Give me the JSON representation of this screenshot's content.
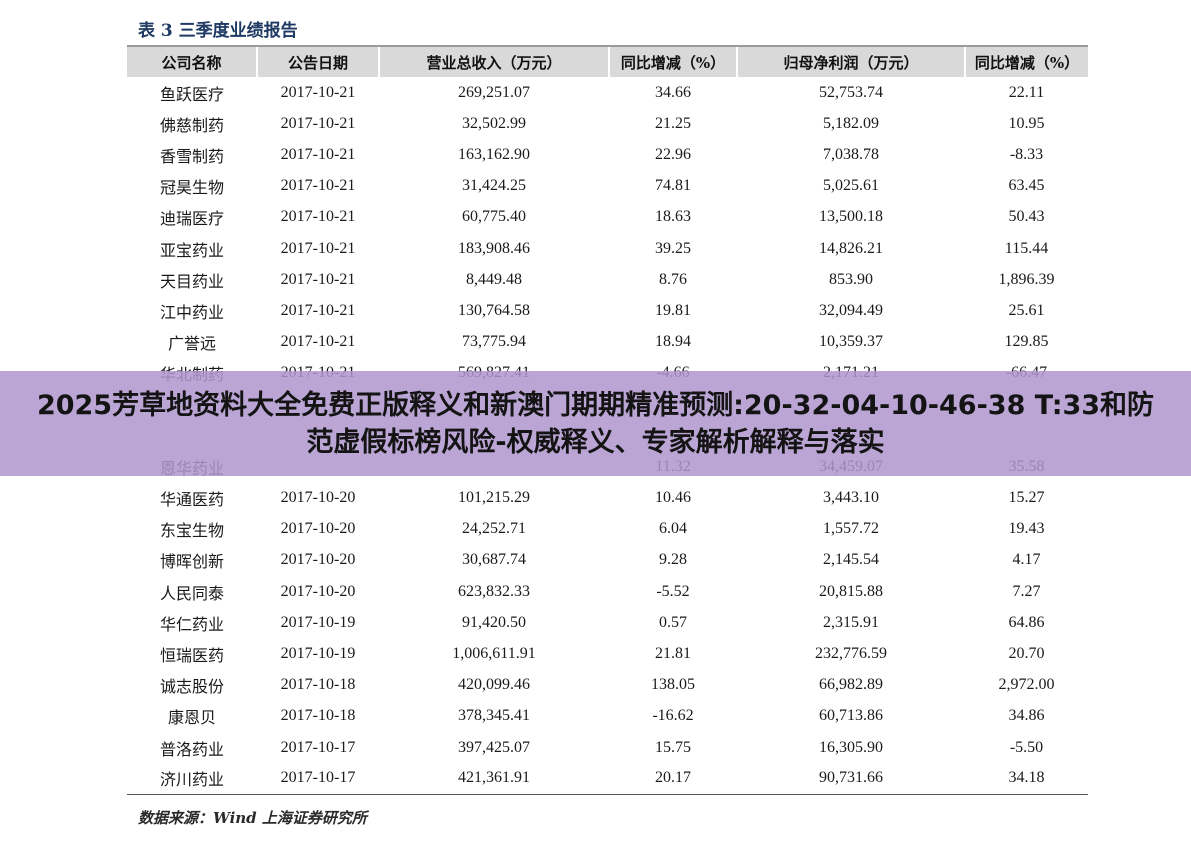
{
  "title": "表 3 三季度业绩报告",
  "table": {
    "headers": [
      "公司名称",
      "公告日期",
      "营业总收入（万元）",
      "同比增减（%）",
      "归母净利润（万元）",
      "同比增减（%）"
    ],
    "rows": [
      [
        "鱼跃医疗",
        "2017-10-21",
        "269,251.07",
        "34.66",
        "52,753.74",
        "22.11"
      ],
      [
        "佛慈制药",
        "2017-10-21",
        "32,502.99",
        "21.25",
        "5,182.09",
        "10.95"
      ],
      [
        "香雪制药",
        "2017-10-21",
        "163,162.90",
        "22.96",
        "7,038.78",
        "-8.33"
      ],
      [
        "冠昊生物",
        "2017-10-21",
        "31,424.25",
        "74.81",
        "5,025.61",
        "63.45"
      ],
      [
        "迪瑞医疗",
        "2017-10-21",
        "60,775.40",
        "18.63",
        "13,500.18",
        "50.43"
      ],
      [
        "亚宝药业",
        "2017-10-21",
        "183,908.46",
        "39.25",
        "14,826.21",
        "115.44"
      ],
      [
        "天目药业",
        "2017-10-21",
        "8,449.48",
        "8.76",
        "853.90",
        "1,896.39"
      ],
      [
        "江中药业",
        "2017-10-21",
        "130,764.58",
        "19.81",
        "32,094.49",
        "25.61"
      ],
      [
        "广誉远",
        "2017-10-21",
        "73,775.94",
        "18.94",
        "10,359.37",
        "129.85"
      ],
      [
        "华北制药",
        "2017-10-21",
        "569,827.41",
        "-4.66",
        "2,171.21",
        "-66.47"
      ],
      [
        "",
        "",
        "",
        "",
        "",
        ""
      ],
      [
        "",
        "",
        "",
        "",
        "",
        ""
      ],
      [
        "恩华药业",
        "",
        "",
        "11.32",
        "34,459.07",
        "35.58"
      ],
      [
        "华通医药",
        "2017-10-20",
        "101,215.29",
        "10.46",
        "3,443.10",
        "15.27"
      ],
      [
        "东宝生物",
        "2017-10-20",
        "24,252.71",
        "6.04",
        "1,557.72",
        "19.43"
      ],
      [
        "博晖创新",
        "2017-10-20",
        "30,687.74",
        "9.28",
        "2,145.54",
        "4.17"
      ],
      [
        "人民同泰",
        "2017-10-20",
        "623,832.33",
        "-5.52",
        "20,815.88",
        "7.27"
      ],
      [
        "华仁药业",
        "2017-10-19",
        "91,420.50",
        "0.57",
        "2,315.91",
        "64.86"
      ],
      [
        "恒瑞医药",
        "2017-10-19",
        "1,006,611.91",
        "21.81",
        "232,776.59",
        "20.70"
      ],
      [
        "诚志股份",
        "2017-10-18",
        "420,099.46",
        "138.05",
        "66,982.89",
        "2,972.00"
      ],
      [
        "康恩贝",
        "2017-10-18",
        "378,345.41",
        "-16.62",
        "60,713.86",
        "34.86"
      ],
      [
        "普洛药业",
        "2017-10-17",
        "397,425.07",
        "15.75",
        "16,305.90",
        "-5.50"
      ],
      [
        "济川药业",
        "2017-10-17",
        "421,361.91",
        "20.17",
        "90,731.66",
        "34.18"
      ]
    ]
  },
  "source": "数据来源：Wind 上海证券研究所",
  "banner": {
    "text": "2025芳草地资料大全免费正版释义和新澳门期期精准预测:20-32-04-10-46-38 T:33和防范虚假标榜风险-权威释义、专家解析解释与落实",
    "color": "#af96cd"
  }
}
